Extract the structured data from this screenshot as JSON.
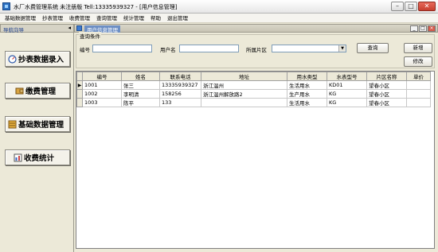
{
  "window": {
    "title": "水厂水费管理系统 未注册版 Tell:13335939327 - [用户信息管理]"
  },
  "menu": [
    "基础数据管理",
    "抄表管理",
    "收费管理",
    "查询管理",
    "统计管理",
    "帮助",
    "退出管理"
  ],
  "nav": {
    "header": "导航向导",
    "buttons": [
      {
        "label": "抄表数据录入",
        "icon": "meter-icon"
      },
      {
        "label": "缴费管理",
        "icon": "wallet-icon"
      },
      {
        "label": "基础数据管理",
        "icon": "database-icon"
      },
      {
        "label": "收费统计",
        "icon": "chart-icon"
      }
    ]
  },
  "child": {
    "title": "用户信息管理"
  },
  "query": {
    "legend": "查询条件",
    "id_label": "编号",
    "id_value": "",
    "username_label": "用户名",
    "username_value": "",
    "area_label": "所属片区",
    "area_value": "",
    "search_button": "查询",
    "add_button": "新增",
    "edit_button": "修改"
  },
  "table": {
    "columns": [
      "编号",
      "姓名",
      "联系电话",
      "地址",
      "用水类型",
      "水表型号",
      "片区名称",
      "单价"
    ],
    "rows": [
      [
        "1001",
        "张三",
        "13335939327",
        "浙江温州",
        "生活用水",
        "KD01",
        "望春小区",
        ""
      ],
      [
        "1002",
        "李明清",
        "158256",
        "浙江温州解放路2",
        "生产用水",
        "KG",
        "望春小区",
        ""
      ],
      [
        "1003",
        "陈平",
        "133",
        "",
        "生活用水",
        "KG",
        "望春小区",
        ""
      ]
    ],
    "current_row_marker": "▶"
  },
  "colors": {
    "nav_header_text": "#1d3f8c",
    "child_title_bg": "#6d8fc4"
  }
}
